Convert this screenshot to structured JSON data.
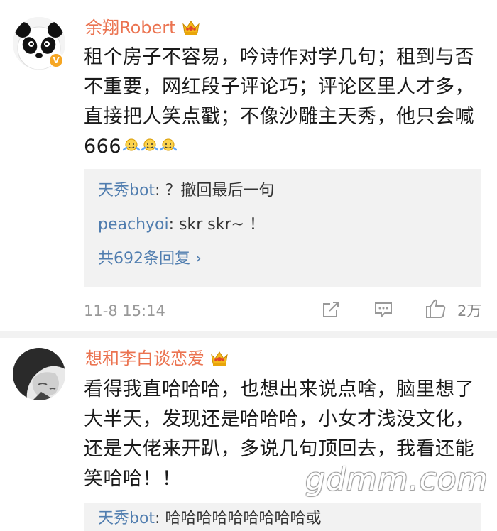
{
  "comments": [
    {
      "username": "余翔Robert",
      "avatar_icon": "panda-avatar",
      "verified": true,
      "text": "租个房子不容易，吟诗作对学几句；租到与否不重要，网红段子评论巧；评论区里人才多，直接把人笑点戳；不像沙雕主天秀，他只会喊666",
      "emoji_icons": [
        "shrug-emoji",
        "shrug-emoji",
        "shrug-emoji"
      ],
      "replies": [
        {
          "name": "天秀bot",
          "sep": ":",
          "text": " ？撤回最后一句"
        },
        {
          "name": "peachyoi",
          "sep": ":",
          "text": " skr skr~ ！"
        }
      ],
      "more_replies": "共692条回复 ›",
      "time": "11-8 15:14",
      "likes": "2万"
    },
    {
      "username": "想和李白谈恋爱",
      "avatar_icon": "girl-avatar",
      "text": "看得我直哈哈哈，也想出来说点啥，脑里想了大半天，发现还是哈哈哈，小女才浅没文化，还是大佬来开趴，多说几句顶回去，我看还能笑哈哈！！",
      "replies": [
        {
          "name": "天秀bot",
          "sep": ":",
          "text": " 哈哈哈哈哈哈哈哈哈或"
        }
      ]
    }
  ],
  "watermark": "gdmm.com",
  "colors": {
    "username": "#eb7350",
    "reply_name": "#507daf",
    "reply_bg": "#f2f2f2",
    "meta": "#999999"
  }
}
